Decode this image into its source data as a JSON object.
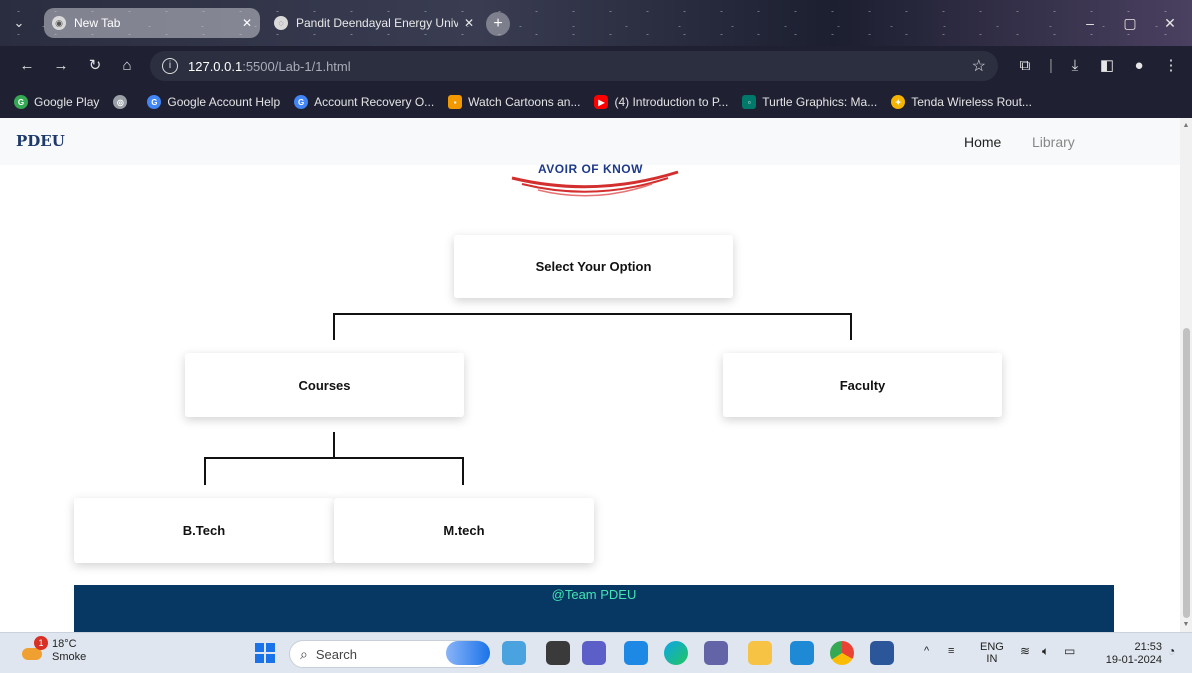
{
  "browser": {
    "tabs": [
      {
        "title": "New Tab",
        "active": true
      },
      {
        "title": "Pandit Deendayal Energy Univ",
        "active": false
      }
    ],
    "url_host": "127.0.0.1",
    "url_path": ":5500/Lab-1/1.html",
    "bookmarks": [
      {
        "label": "Google Play",
        "icon_color": "#34a853"
      },
      {
        "label": "",
        "icon_color": "#9aa0a6"
      },
      {
        "label": "Google Account Help",
        "icon_color": "#4285f4"
      },
      {
        "label": "Account Recovery O...",
        "icon_color": "#4285f4"
      },
      {
        "label": "Watch Cartoons an...",
        "icon_color": "#f29900"
      },
      {
        "label": "(4) Introduction to P...",
        "icon_color": "#ff0000"
      },
      {
        "label": "Turtle Graphics: Ma...",
        "icon_color": "#00796b"
      },
      {
        "label": "Tenda Wireless Rout...",
        "icon_color": "#f4b400"
      }
    ]
  },
  "page": {
    "brand": "PDEU",
    "nav": {
      "home": "Home",
      "library": "Library"
    },
    "logo_text": "AVOIR OF KNOW",
    "root_card": "Select Your Option",
    "level1": {
      "left": "Courses",
      "right": "Faculty"
    },
    "level2": {
      "left": "B.Tech",
      "right": "M.tech"
    },
    "footer": "@Team PDEU"
  },
  "taskbar": {
    "weather_temp": "18°C",
    "weather_desc": "Smoke",
    "weather_badge": "1",
    "search_placeholder": "Search",
    "lang": "ENG",
    "region": "IN",
    "time": "21:53",
    "date": "19-01-2024"
  },
  "colors": {
    "footer_bg": "#073763",
    "footer_text": "#43e5b3",
    "brand": "#1e3a6a"
  }
}
